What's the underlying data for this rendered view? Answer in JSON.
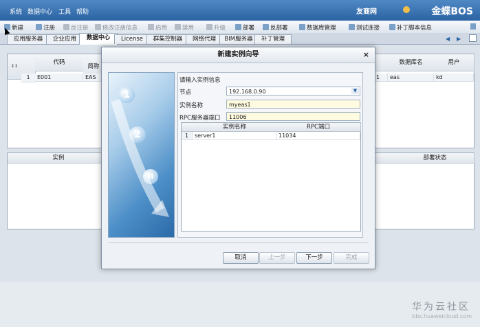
{
  "menubar": {
    "items": [
      "系统",
      "数据中心",
      "工具",
      "帮助"
    ],
    "brand_small": "友商网",
    "brand": "金蝶BOS"
  },
  "toolbar": {
    "buttons": [
      {
        "label": "新建",
        "icon": "new-icon",
        "enabled": true
      },
      {
        "label": "注册",
        "icon": "register-icon",
        "enabled": true
      },
      {
        "label": "反注册",
        "icon": "unregister-icon",
        "enabled": false
      },
      {
        "label": "修改注册信息",
        "icon": "edit-register-icon",
        "enabled": false
      },
      {
        "label": "启用",
        "icon": "enable-icon",
        "enabled": false
      },
      {
        "label": "禁用",
        "icon": "disable-icon",
        "enabled": false
      },
      {
        "label": "升级",
        "icon": "upgrade-icon",
        "enabled": false
      },
      {
        "label": "部署",
        "icon": "deploy-icon",
        "enabled": true
      },
      {
        "label": "反部署",
        "icon": "undeploy-icon",
        "enabled": true
      },
      {
        "label": "数据库管理",
        "icon": "database-icon",
        "enabled": true
      },
      {
        "label": "测试连接",
        "icon": "test-connection-icon",
        "enabled": true
      },
      {
        "label": "补丁脚本信息",
        "icon": "patch-script-icon",
        "enabled": true
      }
    ]
  },
  "tabs": [
    "应用服务器",
    "企业应用",
    "数据中心",
    "License",
    "群集控制器",
    "网络代理",
    "BIM服务器",
    "补丁管理"
  ],
  "active_tab": "数据中心",
  "grid": {
    "headers": [
      "代码",
      "简称",
      "数据库名",
      "用户"
    ],
    "row": {
      "num": "1",
      "code": "E001",
      "short": "EAS",
      "db": "eas",
      "user": "kd",
      "extra": "1"
    }
  },
  "grid2": {
    "headers": [
      "实例",
      "部署状态"
    ]
  },
  "dialog": {
    "title": "新建实例向导",
    "prompt": "请输入实例信息",
    "node_label": "节点",
    "node_value": "192.168.0.90",
    "name_label": "实例名称",
    "name_value": "myeas1",
    "port_label": "RPC服务器端口",
    "port_value": "11006",
    "table_headers": [
      "实例名称",
      "RPC端口"
    ],
    "table_rows": [
      {
        "num": "1",
        "name": "server1",
        "port": "11034"
      }
    ],
    "bubbles": [
      "1",
      "2",
      "n"
    ],
    "buttons": {
      "cancel": "取消",
      "prev": "上一步",
      "next": "下一步",
      "finish": "完成"
    }
  },
  "watermark": {
    "text": "华为云社区",
    "url": "bbs.huaweicloud.com"
  },
  "colors": {
    "menubar": "#2c63a3",
    "dialog_bg": "#eef1f5",
    "field_highlight": "#fffbe0"
  }
}
